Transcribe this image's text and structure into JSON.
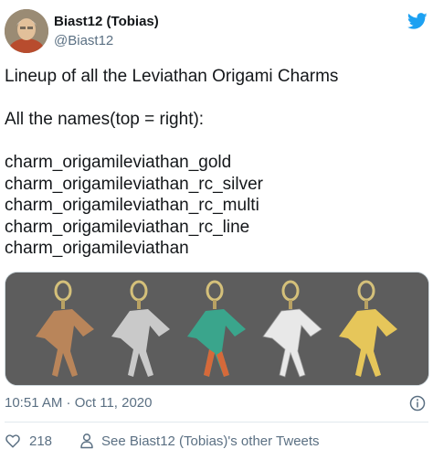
{
  "author": {
    "display_name": "Biast12 (Tobias)",
    "handle": "@Biast12",
    "avatar_icon": "user-avatar",
    "platform_icon": "twitter-bird-icon"
  },
  "tweet": {
    "text_lines": [
      "Lineup of all the Leviathan Origami Charms",
      "",
      "All the names(top = right):",
      "",
      "charm_origamileviathan_gold",
      "charm_origamileviathan_rc_silver",
      "charm_origamileviathan_rc_multi",
      "charm_origamileviathan_rc_line",
      "charm_origamileviathan"
    ],
    "text": "Lineup of all the Leviathan Origami Charms\n\nAll the names(top = right):\n\ncharm_origamileviathan_gold\ncharm_origamileviathan_rc_silver\ncharm_origamileviathan_rc_multi\ncharm_origamileviathan_rc_line\ncharm_origamileviathan"
  },
  "media": {
    "charms": [
      {
        "variant": "bronze",
        "color": "#b9855a"
      },
      {
        "variant": "silver",
        "color": "#c9c9c9"
      },
      {
        "variant": "multi",
        "color": "#3aa58c"
      },
      {
        "variant": "line",
        "color": "#e8e8e8"
      },
      {
        "variant": "gold",
        "color": "#e6c65a"
      }
    ]
  },
  "meta": {
    "timestamp": "10:51 AM · Oct 11, 2020",
    "info_icon": "info-icon"
  },
  "actions": {
    "like_icon": "heart-icon",
    "like_count": "218",
    "profile_icon": "person-icon",
    "other_tweets_label": "See Biast12 (Tobias)'s other Tweets"
  },
  "colors": {
    "brand": "#1da1f2",
    "text_primary": "#14171a",
    "text_secondary": "#5b7083",
    "media_background": "#5b5b5b"
  }
}
